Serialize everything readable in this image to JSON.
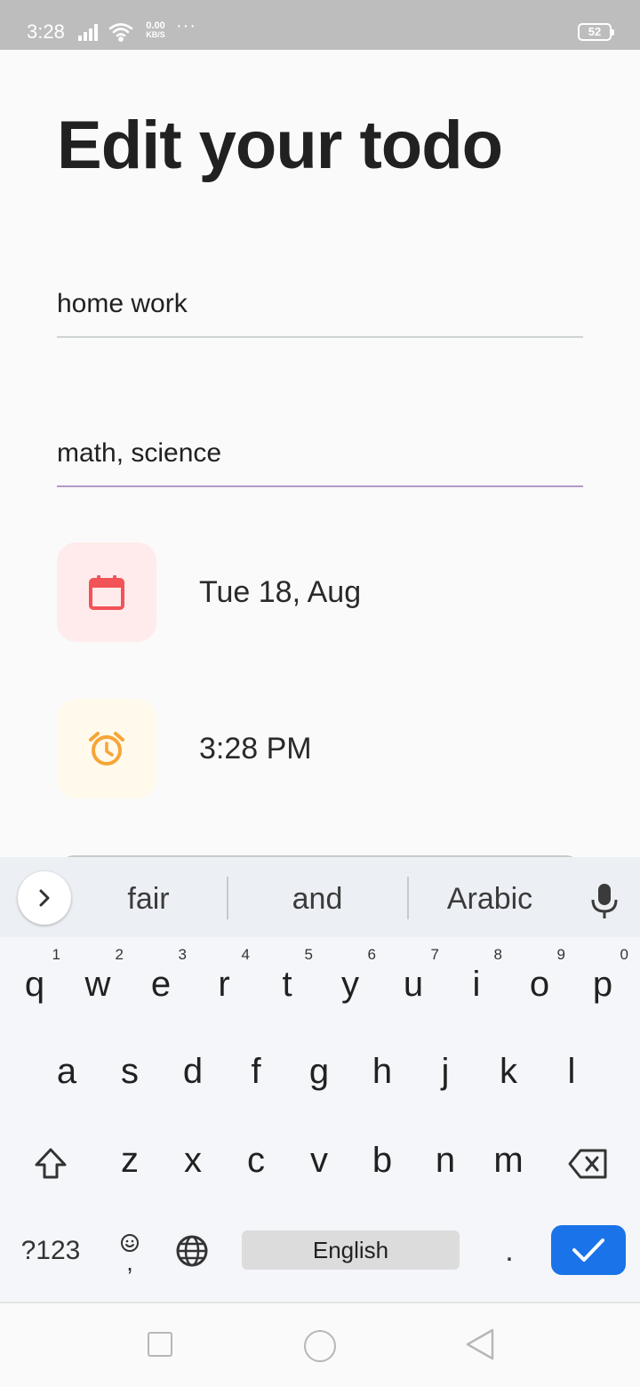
{
  "status_bar": {
    "time": "3:28",
    "net_speed_value": "0.00",
    "net_speed_unit": "KB/S",
    "more": "···",
    "battery": "52",
    "icons": [
      "signal-icon",
      "wifi-icon"
    ]
  },
  "page": {
    "title": "Edit your todo"
  },
  "form": {
    "title_value": "home work",
    "description_value": "math, science",
    "description_focused": true,
    "date_text": "Tue 18, Aug",
    "time_text": "3:28 PM"
  },
  "colors": {
    "date_tile_bg": "#ffebeb",
    "date_icon": "#f25357",
    "time_tile_bg": "#fffaec",
    "time_icon": "#f7a536",
    "focused_underline": "#b39ac8",
    "enter_key": "#1a73e8"
  },
  "keyboard": {
    "suggestions": [
      "fair",
      "and",
      "Arabic"
    ],
    "row1": [
      {
        "key": "q",
        "hint": "1"
      },
      {
        "key": "w",
        "hint": "2"
      },
      {
        "key": "e",
        "hint": "3"
      },
      {
        "key": "r",
        "hint": "4"
      },
      {
        "key": "t",
        "hint": "5"
      },
      {
        "key": "y",
        "hint": "6"
      },
      {
        "key": "u",
        "hint": "7"
      },
      {
        "key": "i",
        "hint": "8"
      },
      {
        "key": "o",
        "hint": "9"
      },
      {
        "key": "p",
        "hint": "0"
      }
    ],
    "row2": [
      "a",
      "s",
      "d",
      "f",
      "g",
      "h",
      "j",
      "k",
      "l"
    ],
    "row3": [
      "z",
      "x",
      "c",
      "v",
      "b",
      "n",
      "m"
    ],
    "symbols_key": "?123",
    "emoji_comma": ",",
    "space_label": "English",
    "period_key": "."
  },
  "nav_bar": {
    "icons": [
      "recents-icon",
      "home-icon",
      "back-icon"
    ]
  }
}
